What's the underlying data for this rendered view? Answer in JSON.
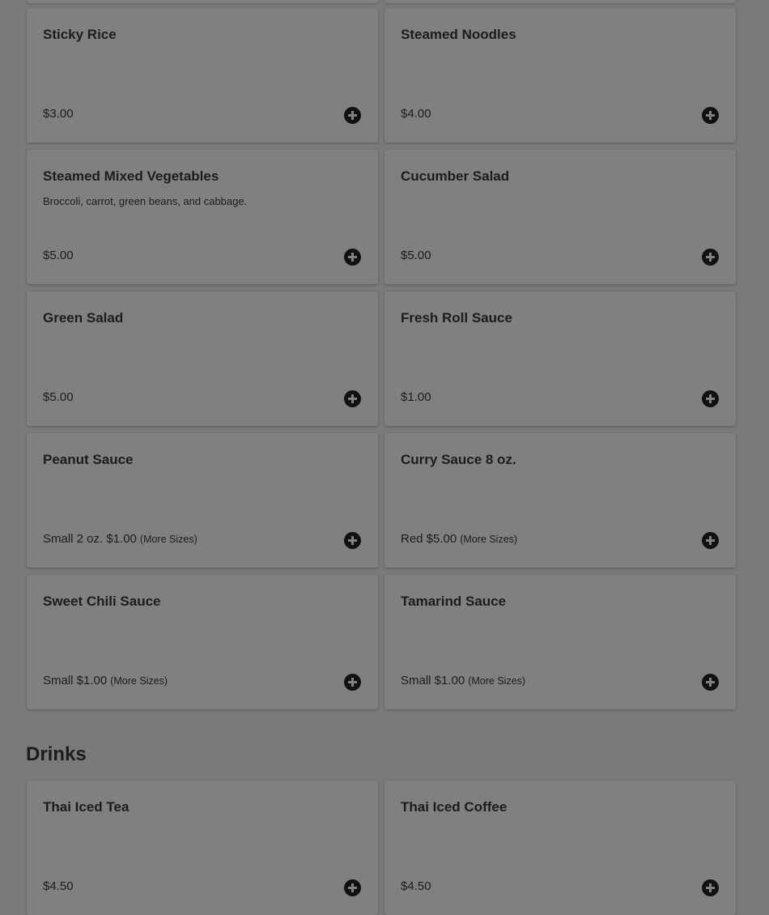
{
  "sections": [
    {
      "items": [
        {
          "name": "Sticky Rice",
          "desc": "",
          "price": "$3.00",
          "more": ""
        },
        {
          "name": "Steamed Noodles",
          "desc": "",
          "price": "$4.00",
          "more": ""
        },
        {
          "name": "Steamed Mixed Vegetables",
          "desc": "Broccoli, carrot, green beans, and cabbage.",
          "price": "$5.00",
          "more": ""
        },
        {
          "name": "Cucumber Salad",
          "desc": "",
          "price": "$5.00",
          "more": ""
        },
        {
          "name": "Green Salad",
          "desc": "",
          "price": "$5.00",
          "more": ""
        },
        {
          "name": "Fresh Roll Sauce",
          "desc": "",
          "price": "$1.00",
          "more": ""
        },
        {
          "name": "Peanut Sauce",
          "desc": "",
          "price": "Small 2 oz. $1.00",
          "more": "(More Sizes)"
        },
        {
          "name": "Curry Sauce 8 oz.",
          "desc": "",
          "price": "Red $5.00",
          "more": "(More Sizes)"
        },
        {
          "name": "Sweet Chili Sauce",
          "desc": "",
          "price": "Small $1.00",
          "more": "(More Sizes)"
        },
        {
          "name": "Tamarind Sauce",
          "desc": "",
          "price": "Small $1.00",
          "more": "(More Sizes)"
        }
      ]
    },
    {
      "title": "Drinks",
      "items": [
        {
          "name": "Thai Iced Tea",
          "desc": "",
          "price": "$4.50",
          "more": ""
        },
        {
          "name": "Thai Iced Coffee",
          "desc": "",
          "price": "$4.50",
          "more": ""
        }
      ]
    }
  ],
  "icons": {
    "add": "plus-circle-icon"
  },
  "colors": {
    "overlay_bg": "#7a7a7a",
    "card_bg": "#808080",
    "text": "#1c1c1c"
  }
}
